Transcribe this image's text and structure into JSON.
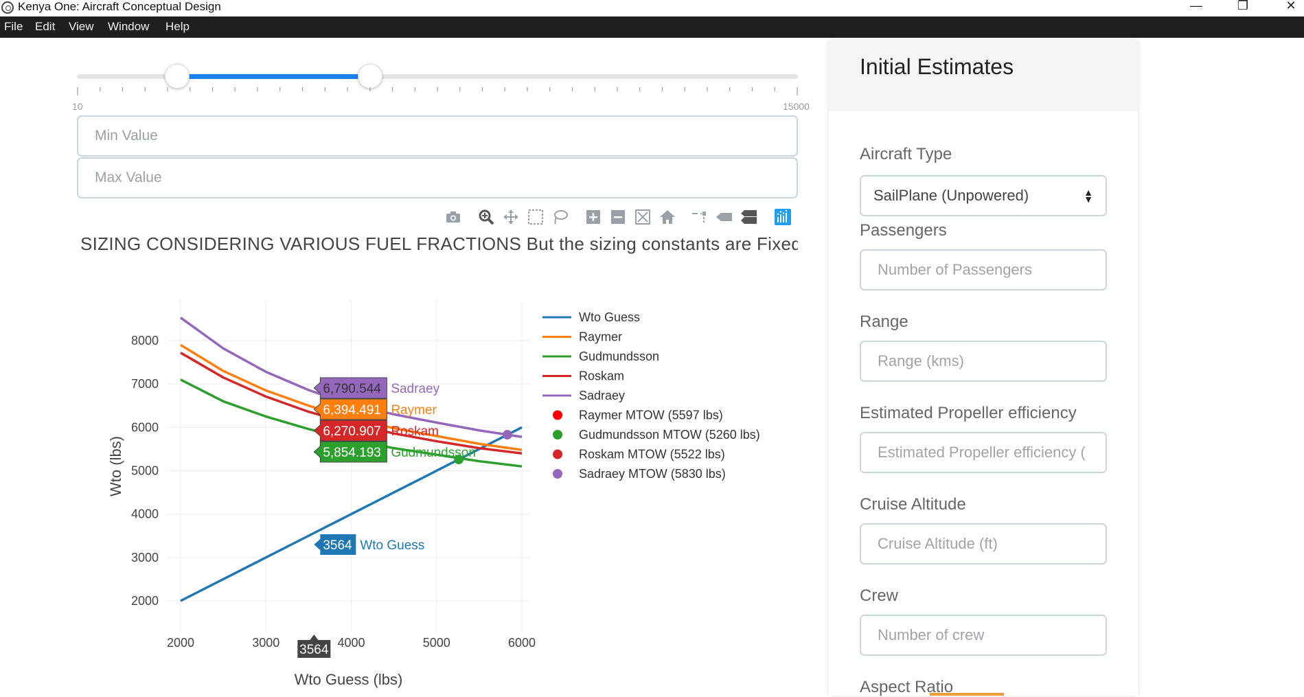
{
  "window": {
    "title": "Kenya One: Aircraft Conceptual Design",
    "minimize": "—",
    "restore": "❐",
    "close": "✕"
  },
  "menu": [
    "File",
    "Edit",
    "View",
    "Window",
    "Help"
  ],
  "slider": {
    "min_label": "10",
    "max_label": "15000",
    "min": 10,
    "max": 15000,
    "low": 2100,
    "high": 6100
  },
  "inputs": {
    "min_placeholder": "Min Value",
    "max_placeholder": "Max Value"
  },
  "toolbar_icons": [
    "camera-icon",
    "zoom-icon",
    "pan-icon",
    "box-select-icon",
    "lasso-icon",
    "zoom-in-icon",
    "zoom-out-icon",
    "autoscale-icon",
    "home-icon",
    "spike-lines-icon",
    "hover-closest-icon",
    "hover-compare-icon",
    "plotly-logo-icon"
  ],
  "chart_title": "SIZING CONSIDERING VARIOUS FUEL FRACTIONS  But the sizing constants are Fixed",
  "chart_data": {
    "type": "line",
    "xlabel": "Wto Guess (lbs)",
    "ylabel": "Wto (lbs)",
    "xlim": [
      2000,
      6000
    ],
    "ylim": [
      2000,
      8000
    ],
    "xticks": [
      2000,
      3000,
      4000,
      5000,
      6000
    ],
    "yticks": [
      2000,
      3000,
      4000,
      5000,
      6000,
      7000,
      8000
    ],
    "grid": true,
    "legend_position": "right",
    "x": [
      2000,
      2500,
      3000,
      3500,
      4000,
      4500,
      5000,
      5500,
      6000
    ],
    "series": [
      {
        "name": "Wto Guess",
        "color": "#1f77b4",
        "values": [
          2000,
          2500,
          3000,
          3500,
          4000,
          4500,
          5000,
          5500,
          6000
        ]
      },
      {
        "name": "Raymer",
        "color": "#ff7f0e",
        "values": [
          7900,
          7300,
          6850,
          6500,
          6200,
          5980,
          5800,
          5620,
          5480
        ]
      },
      {
        "name": "Gudmundsson",
        "color": "#2ca02c",
        "values": [
          7100,
          6600,
          6250,
          5960,
          5720,
          5520,
          5370,
          5220,
          5100
        ]
      },
      {
        "name": "Roskam",
        "color": "#d62728",
        "values": [
          7720,
          7150,
          6710,
          6360,
          6080,
          5860,
          5680,
          5520,
          5400
        ]
      },
      {
        "name": "Sadraey",
        "color": "#9467bd",
        "values": [
          8530,
          7820,
          7280,
          6860,
          6530,
          6300,
          6110,
          5930,
          5780
        ]
      }
    ],
    "mtow_points": [
      {
        "name": "Raymer MTOW (5597 lbs)",
        "color": "#ff0000",
        "x": 5597,
        "y": 5597
      },
      {
        "name": "Gudmundsson MTOW (5260 lbs)",
        "color": "#2ca02c",
        "x": 5260,
        "y": 5260
      },
      {
        "name": "Roskam MTOW (5522 lbs)",
        "color": "#d62728",
        "x": 5522,
        "y": 5522
      },
      {
        "name": "Sadraey MTOW (5830 lbs)",
        "color": "#9467bd",
        "x": 5830,
        "y": 5830
      }
    ],
    "hover": {
      "x": 3564,
      "x_label": "3564",
      "labels": [
        {
          "value": "6,790.544",
          "name": "Sadraey",
          "color": "#9467bd",
          "y": 6790.544
        },
        {
          "value": "6,394.491",
          "name": "Raymer",
          "color": "#ff7f0e",
          "y": 6394.491
        },
        {
          "value": "6,270.907",
          "name": "Roskam",
          "color": "#d62728",
          "y": 6270.907
        },
        {
          "value": "5,854.193",
          "name": "Gudmundsson",
          "color": "#2ca02c",
          "y": 5854.193
        },
        {
          "value": "3564",
          "name": "Wto Guess",
          "color": "#1f77b4",
          "y": 3564
        }
      ]
    }
  },
  "panel": {
    "title": "Initial Estimates",
    "fields": [
      {
        "label": "Aircraft Type",
        "value": "SailPlane (Unpowered)",
        "kind": "select"
      },
      {
        "label": "Passengers",
        "placeholder": "Number of Passengers"
      },
      {
        "label": "Range",
        "placeholder": "Range (kms)"
      },
      {
        "label": "Estimated Propeller efficiency",
        "placeholder": "Estimated Propeller efficiency ("
      },
      {
        "label": "Cruise Altitude",
        "placeholder": "Cruise Altitude (ft)"
      },
      {
        "label": "Crew",
        "placeholder": "Number of crew"
      },
      {
        "label": "Aspect Ratio"
      }
    ]
  }
}
